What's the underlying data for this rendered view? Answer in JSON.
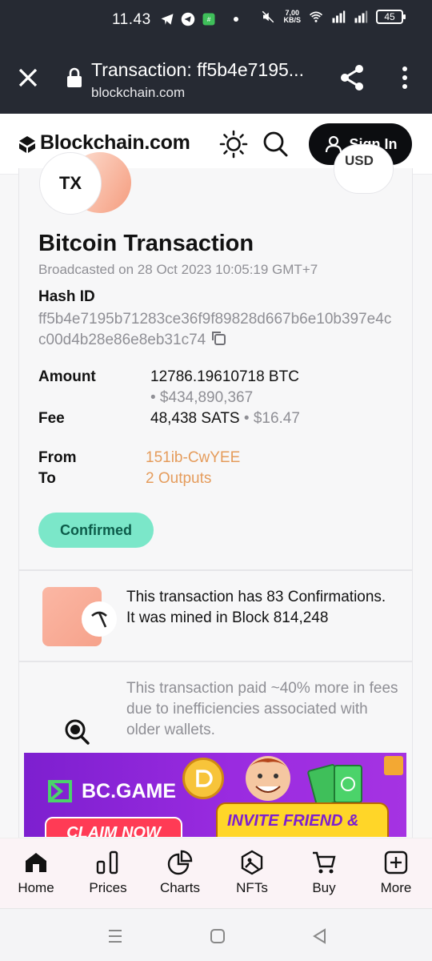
{
  "status_bar": {
    "time": "11.43",
    "net_speed_value": "7,00",
    "net_speed_unit": "KB/S",
    "battery": "45"
  },
  "browser": {
    "title": "Transaction: ff5b4e7195...",
    "url": "blockchain.com"
  },
  "header": {
    "logo_text": "Blockchain.com",
    "sign_in_label": "Sign In"
  },
  "transaction": {
    "badge": "TX",
    "currency_toggle": "USD",
    "title": "Bitcoin Transaction",
    "broadcast": "Broadcasted on 28 Oct 2023 10:05:19 GMT+7",
    "hash_label": "Hash ID",
    "hash_value": "ff5b4e7195b71283ce36f9f89828d667b6e10b397e4cc00d4b28e86e8eb31c74",
    "amount_label": "Amount",
    "amount_btc": "12786.19610718 BTC",
    "amount_usd": "• $434,890,367",
    "fee_label": "Fee",
    "fee_sats": "48,438 SATS",
    "fee_usd": "• $16.47",
    "from_label": "From",
    "from_value": "151ib-CwYEE",
    "to_label": "To",
    "to_value": "2 Outputs",
    "status": "Confirmed"
  },
  "confirmations": {
    "text": "This transaction has 83 Confirmations. It was mined in Block 814,248"
  },
  "fee_note": {
    "text": "This transaction paid ~40% more in fees due to inefficiencies associated with older wallets."
  },
  "ad": {
    "brand": "BC.GAME",
    "claim": "CLAIM NOW",
    "invite": "INVITE FRIEND &"
  },
  "bottom_nav": [
    {
      "label": "Home"
    },
    {
      "label": "Prices"
    },
    {
      "label": "Charts"
    },
    {
      "label": "NFTs"
    },
    {
      "label": "Buy"
    },
    {
      "label": "More"
    }
  ],
  "colors": {
    "dark_bar": "#262a33",
    "confirmed_bg": "#7be7c9",
    "link": "#e59c5c"
  }
}
